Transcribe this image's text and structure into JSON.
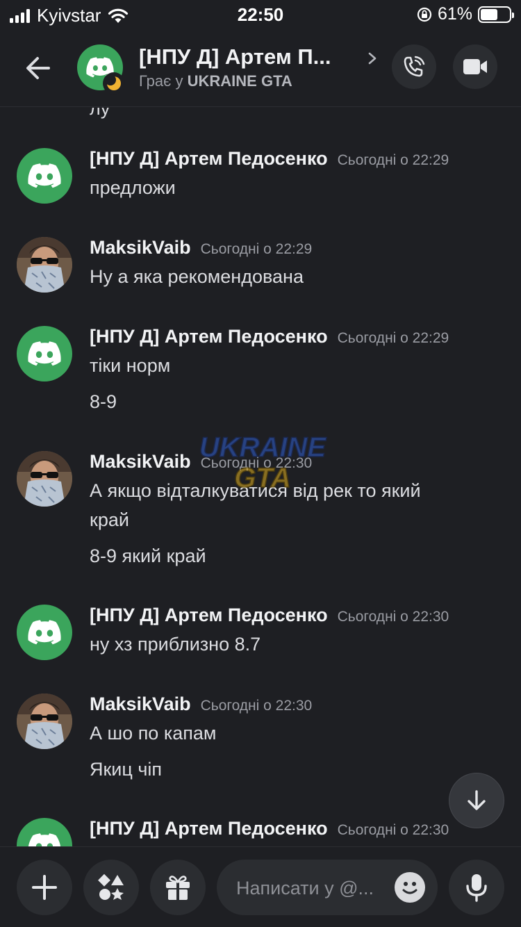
{
  "status_bar": {
    "carrier": "Kyivstar",
    "time": "22:50",
    "battery_percent": "61%",
    "battery_level": 0.61
  },
  "header": {
    "name": "[НПУ Д] Артем П...",
    "activity_prefix": "Грає у",
    "activity_game": "UKRAINE GTA",
    "status": "idle-moon-icon"
  },
  "chat": {
    "partial_top_text": "лу",
    "messages": [
      {
        "author": "[НПУ Д] Артем Педосенко",
        "time": "Сьогодні о 22:29",
        "avatar": "discord",
        "lines": [
          "предложи"
        ]
      },
      {
        "author": "MaksikVaib",
        "time": "Сьогодні о 22:29",
        "avatar": "photo",
        "lines": [
          "Ну а яка рекомендована"
        ]
      },
      {
        "author": "[НПУ Д] Артем Педосенко",
        "time": "Сьогодні о 22:29",
        "avatar": "discord",
        "lines": [
          "тіки норм",
          "8-9"
        ]
      },
      {
        "author": "MaksikVaib",
        "time": "Сьогодні о 22:30",
        "avatar": "photo",
        "lines": [
          "А якщо відталкуватися від рек то який",
          "край",
          "8-9 який край"
        ]
      },
      {
        "author": "[НПУ Д] Артем Педосенко",
        "time": "Сьогодні о 22:30",
        "avatar": "discord",
        "lines": [
          "ну хз приблизно 8.7"
        ]
      },
      {
        "author": "MaksikVaib",
        "time": "Сьогодні о 22:30",
        "avatar": "photo",
        "lines": [
          "А шо по капам",
          "Якиц чіп"
        ]
      },
      {
        "author": "[НПУ Д] Артем Педосенко",
        "time": "Сьогодні о 22:30",
        "avatar": "discord",
        "lines": []
      }
    ],
    "watermark": [
      "UKRAINE",
      "GTA"
    ]
  },
  "composer": {
    "placeholder": "Написати у @..."
  },
  "colors": {
    "background": "#1e1f23",
    "discord_green": "#3ba55c",
    "button_bg": "#2b2d31",
    "timestamp": "#9a9ca3"
  }
}
